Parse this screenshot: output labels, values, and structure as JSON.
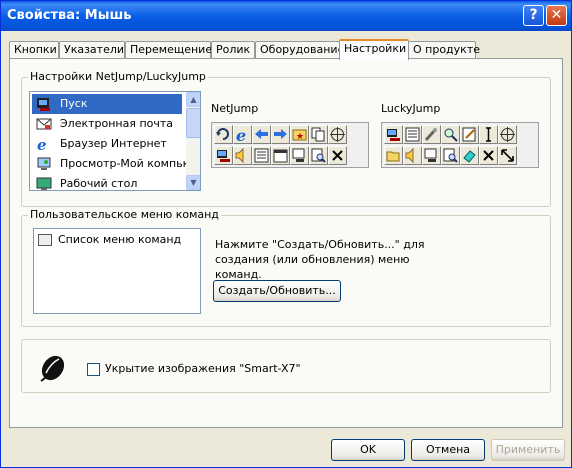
{
  "window": {
    "title": "Свойства: Мышь",
    "help_glyph": "?",
    "close_glyph": "✕"
  },
  "tabs": [
    {
      "label": "Кнопки"
    },
    {
      "label": "Указатели"
    },
    {
      "label": "Перемещение"
    },
    {
      "label": "Ролик"
    },
    {
      "label": "Оборудование"
    },
    {
      "label": "Настройки"
    },
    {
      "label": "О продукте"
    }
  ],
  "active_tab": "Настройки",
  "netjump_group": {
    "title": "Настройки NetJump/LuckyJump",
    "list": [
      {
        "label": "Пуск",
        "selected": true,
        "icon": "start-icon"
      },
      {
        "label": "Электронная почта",
        "selected": false,
        "icon": "email-icon"
      },
      {
        "label": "Браузер Интернет",
        "selected": false,
        "icon": "browser-icon"
      },
      {
        "label": "Просмотр-Мой компьк",
        "selected": false,
        "icon": "my-computer-icon"
      },
      {
        "label": "Рабочий стол",
        "selected": false,
        "icon": "desktop-icon"
      }
    ],
    "netjump_label": "NetJump",
    "luckyjump_label": "LuckyJump"
  },
  "menu_group": {
    "title": "Пользовательское меню команд",
    "list_item": "Список меню команд",
    "info": "Нажмите \"Создать/Обновить...\" для создания (или обновления) меню команд.",
    "create_button": "Создать/Обновить..."
  },
  "smart_group": {
    "checkbox_label": "Укрытие изображения \"Smart-X7\"",
    "checked": false
  },
  "footer": {
    "ok": "OK",
    "cancel": "Отмена",
    "apply": "Применить"
  },
  "colors": {
    "title_bar": "#0a5ee6",
    "selection": "#316ac5",
    "active_tab_accent": "#e68b2c"
  }
}
